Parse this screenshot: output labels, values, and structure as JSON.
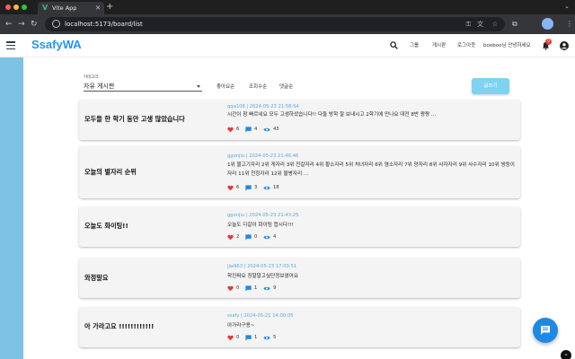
{
  "browser": {
    "tab_title": "Vite App",
    "url": "localhost:5173/board/list",
    "new_tab_label": "+"
  },
  "header": {
    "app_title": "SsafyWA",
    "links": [
      "그룹",
      "게시판",
      "로그아웃"
    ],
    "greeting": "booboo님 안녕하세요",
    "notification_count": "0"
  },
  "filter": {
    "category_label": "카테고리",
    "category_value": "자유 게시판",
    "sort_options": [
      "좋아요순",
      "조회수순",
      "댓글순"
    ],
    "write_button": "글쓰기"
  },
  "posts": [
    {
      "title": "모두들 한 학기 동안 고생 많았습니다",
      "meta": "qqa108 | 2024-05-23 21:58:54",
      "body": "시간이 참 빠르네요 모두 고생하셨습니다!! 다들 방학 잘 보내시고 2학기에 만나요 대전 8반 짱짱 ...",
      "likes": "6",
      "comments": "4",
      "views": "43"
    },
    {
      "title": "오늘의 별자리 순위",
      "meta": "ggonjiu | 2024-05-23 21:46:46",
      "body": "1위 물고기자리 2위 게자리 3위 전갈자리 4위 황소자리 5위 처녀자리 6위 염소자리 7위 양자리 8위 사자자리 9위 사수자리 10위 쌍둥이자리 11위 천칭자리 12위 물병자리 ...",
      "likes": "6",
      "comments": "3",
      "views": "18"
    },
    {
      "title": "오늘도 화이팅!!",
      "meta": "ggonjiu | 2024-05-23 21:43:25",
      "body": "오늘도 디갈이 화이팅 합시다!!!",
      "likes": "2",
      "comments": "0",
      "views": "4"
    },
    {
      "title": "와정말요",
      "meta": "jjw963 | 2024-05-23 17:03:51",
      "body": "학진짜요 정말말고싶단정보였어요",
      "likes": "0",
      "comments": "1",
      "views": "9"
    },
    {
      "title": "아 가라고요 !!!!!!!!!!!!",
      "meta": "ssafy | 2024-05-21 14:00:05",
      "body": "아가라구용~",
      "likes": "0",
      "comments": "1",
      "views": "5"
    }
  ],
  "colors": {
    "brand": "#2196f3",
    "rail": "#7ec3e6",
    "heart": "#e53935",
    "comment": "#1e88e5",
    "views": "#1e88e5",
    "meta": "#58a9d6",
    "write_button": "#7fd3f0",
    "fab": "#1e88e5"
  },
  "icons": {
    "chat_fab": "chat-bubble-icon",
    "like": "heart-icon",
    "comment": "comment-icon",
    "view": "eye-icon"
  }
}
